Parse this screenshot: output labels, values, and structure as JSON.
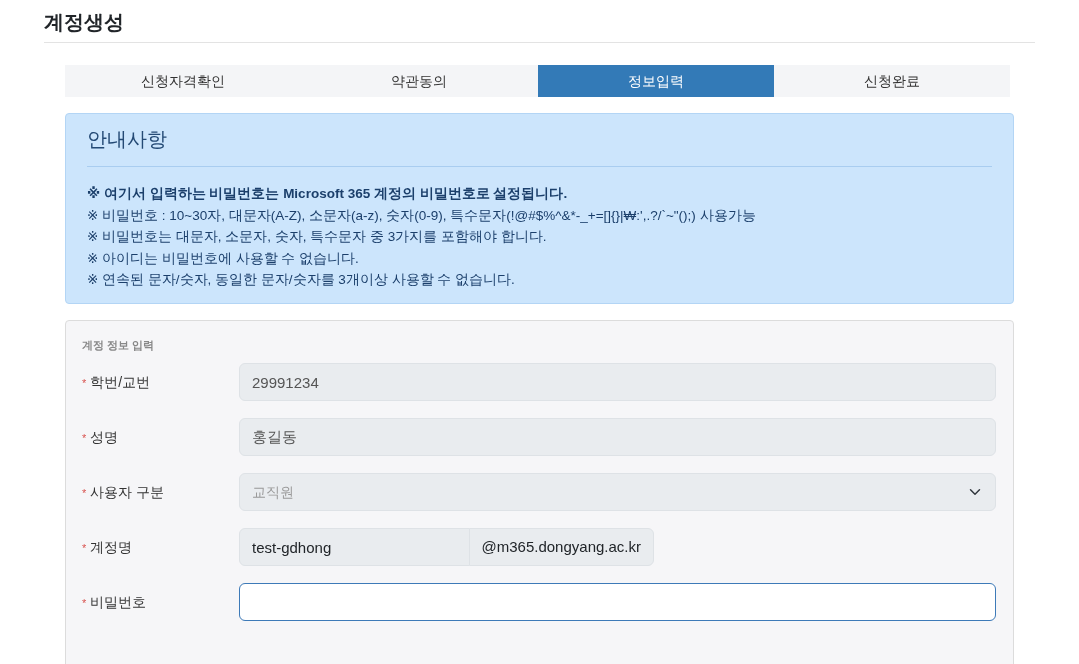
{
  "page_title": "계정생성",
  "steps": [
    {
      "label": "신청자격확인",
      "selected": false
    },
    {
      "label": "약관동의",
      "selected": false
    },
    {
      "label": "정보입력",
      "selected": true
    },
    {
      "label": "신청완료",
      "selected": false
    }
  ],
  "notice": {
    "title": "안내사항",
    "lines": [
      "**※ 여기서 입력하는 비밀번호는 Microsoft 365 계정의 비밀번호로 설정됩니다.**",
      "※ 비밀번호 : 10~30자, 대문자(A-Z), 소문자(a-z), 숫자(0-9), 특수문자(!@#$%^&*-_+=[]{}|₩:',.?/`~\"();) 사용가능",
      "※ 비밀번호는 대문자, 소문자, 숫자, 특수문자 중 3가지를 포함해야 합니다.",
      "※ 아이디는 비밀번호에 사용할 수 없습니다.",
      "※ 연속된 문자/숫자, 동일한 문자/숫자를 3개이상 사용할 수 없습니다."
    ]
  },
  "form": {
    "legend": "계정 정보 입력",
    "fields": [
      {
        "kind": "readonly",
        "label": "학번/교번",
        "required_mark": "*",
        "value": "29991234"
      },
      {
        "kind": "readonly",
        "label": "성명",
        "required_mark": "*",
        "value": "홍길동"
      },
      {
        "kind": "select",
        "label": "사용자 구분",
        "required_mark": "*",
        "value": "교직원",
        "disabled": true
      },
      {
        "kind": "account",
        "label": "계정명",
        "required_mark": "*",
        "value": "test-gdhong",
        "suffix": "@m365.dongyang.ac.kr"
      },
      {
        "kind": "password",
        "label": "비밀번호",
        "required_mark": "*",
        "focused": true
      }
    ]
  }
}
